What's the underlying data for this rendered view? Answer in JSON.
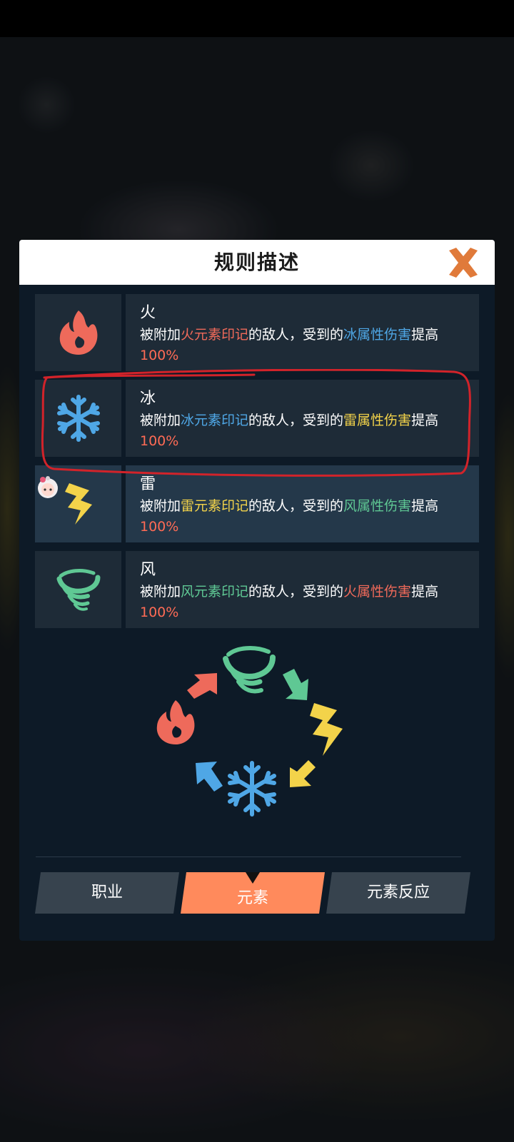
{
  "dialog": {
    "title": "规则描述"
  },
  "colors": {
    "fire": "#f06a5a",
    "ice": "#4fa7e6",
    "thunder": "#f3d34a",
    "wind": "#5fc894",
    "highlight_value": "#ff6b55",
    "accent_tab": "#ff8a5c",
    "close": "#e07a3a"
  },
  "elements": [
    {
      "name": "火",
      "icon": "fire-icon",
      "desc_prefix": "被附加",
      "desc_mark": "火元素印记",
      "desc_mid": "的敌人，受到的",
      "desc_damage": "冰属性伤害",
      "desc_suffix": "提高",
      "desc_value": "100%"
    },
    {
      "name": "冰",
      "icon": "snowflake-icon",
      "desc_prefix": "被附加",
      "desc_mark": "冰元素印记",
      "desc_mid": "的敌人，受到的",
      "desc_damage": "雷属性伤害",
      "desc_suffix": "提高",
      "desc_value": "100%"
    },
    {
      "name": "雷",
      "icon": "lightning-icon",
      "desc_prefix": "被附加",
      "desc_mark": "雷元素印记",
      "desc_mid": "的敌人，受到的",
      "desc_damage": "风属性伤害",
      "desc_suffix": "提高",
      "desc_value": "100%"
    },
    {
      "name": "风",
      "icon": "wind-icon",
      "desc_prefix": "被附加",
      "desc_mark": "风元素印记",
      "desc_mid": "的敌人，受到的",
      "desc_damage": "火属性伤害",
      "desc_suffix": "提高",
      "desc_value": "100%"
    }
  ],
  "tabs": [
    {
      "label": "职业",
      "selected": false
    },
    {
      "label": "元素",
      "selected": true
    },
    {
      "label": "元素反应",
      "selected": false
    }
  ]
}
